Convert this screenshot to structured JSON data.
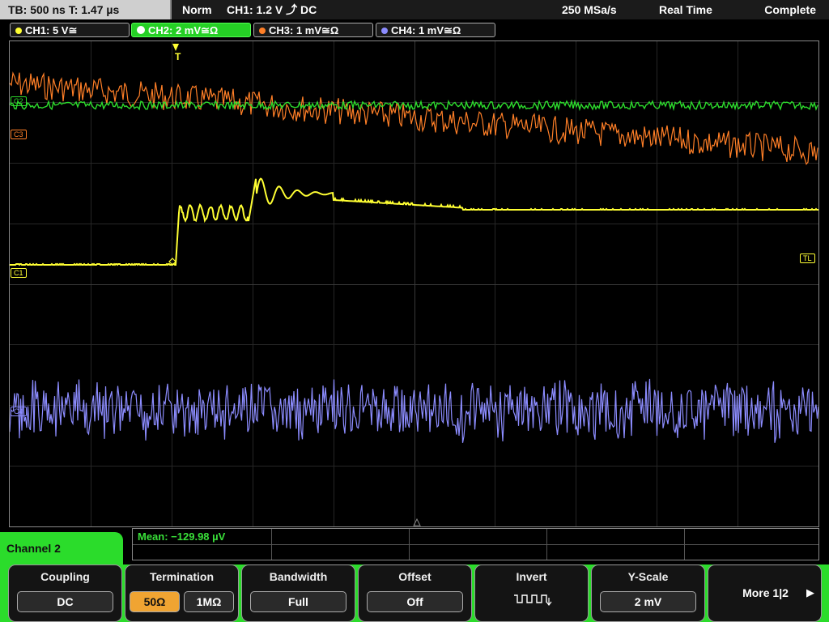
{
  "topbar": {
    "timebase": "TB: 500 ns  T: 1.47 µs",
    "mode": "Norm",
    "trigger": "CH1: 1.2 V ⤴ DC",
    "sample_rate": "250 MSa/s",
    "acq_mode": "Real Time",
    "status": "Complete"
  },
  "channels": [
    {
      "label": "CH1: 5 V≅",
      "color": "#ffff33"
    },
    {
      "label": "CH2: 2 mV≅Ω",
      "color": "#2ddc2d"
    },
    {
      "label": "CH3: 1 mV≅Ω",
      "color": "#ff7f27"
    },
    {
      "label": "CH4: 1 mV≅Ω",
      "color": "#8c8cff"
    }
  ],
  "markers": {
    "trigger": "T",
    "c2": "C2",
    "c3": "C3",
    "c1": "C1",
    "c4": "C4",
    "tl": "TL"
  },
  "measurement": {
    "text": "Mean: −129.98 µV"
  },
  "channel_panel": {
    "title": "Channel 2"
  },
  "softkeys": {
    "coupling": {
      "title": "Coupling",
      "value": "DC"
    },
    "termination": {
      "title": "Termination",
      "opt1": "50Ω",
      "opt2": "1MΩ"
    },
    "bandwidth": {
      "title": "Bandwidth",
      "value": "Full"
    },
    "offset": {
      "title": "Offset",
      "value": "Off"
    },
    "invert": {
      "title": "Invert"
    },
    "yscale": {
      "title": "Y-Scale",
      "value": "2 mV"
    },
    "more": {
      "label": "More 1|2"
    }
  }
}
